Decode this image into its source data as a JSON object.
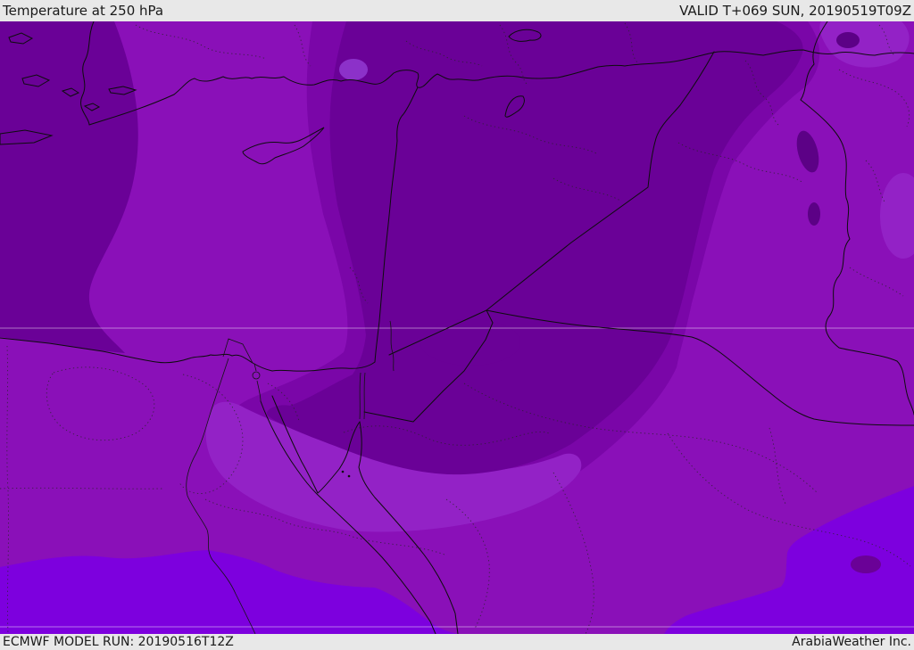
{
  "header": {
    "title": "Temperature at 250 hPa",
    "valid_time": "VALID T+069 SUN, 20190519T09Z"
  },
  "footer": {
    "model_run": "ECMWF MODEL RUN: 20190516T12Z",
    "credit": "ArabiaWeather Inc."
  },
  "map": {
    "parameter": "Temperature at 250 hPa",
    "model": "ECMWF",
    "palette": {
      "base": "#8a10b8",
      "band_dark": "#6a0197",
      "band_mid": "#7a06a8",
      "band_light": "#9322c6",
      "band_lighter": "#8c31c9",
      "band_bright": "#7d00de",
      "lake_dark": "#5c0186",
      "bar_bg": "#e8e8e8",
      "bar_text": "#1a1a1a",
      "line": "#0d0d0d"
    }
  }
}
